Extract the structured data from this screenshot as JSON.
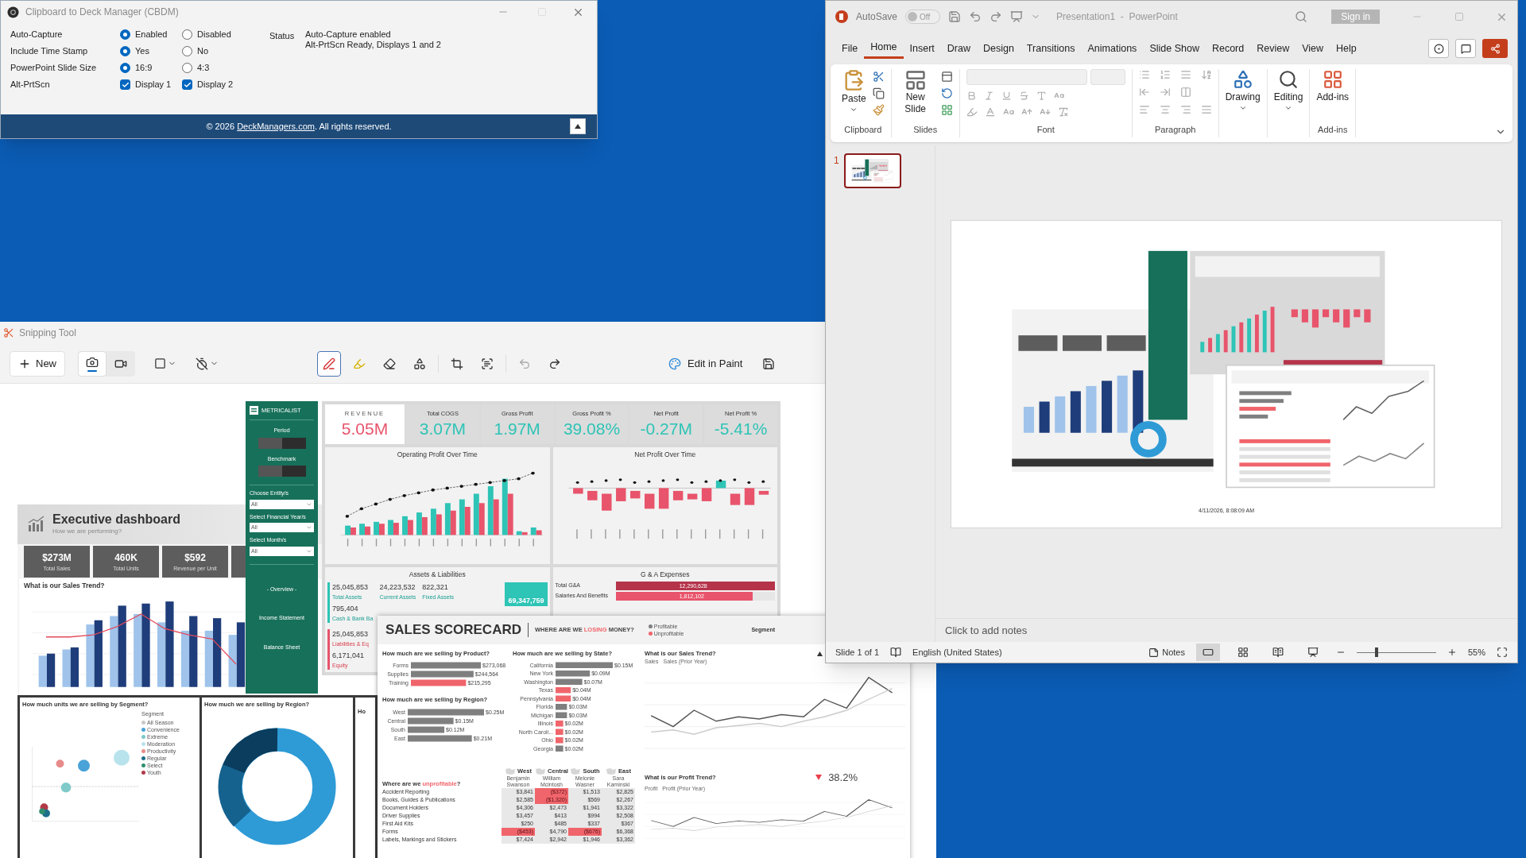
{
  "clipboard_window": {
    "title": "Clipboard to Deck Manager (CBDM)",
    "settings": [
      {
        "label": "Auto-Capture",
        "kind": "radio",
        "options": [
          {
            "label": "Enabled",
            "selected": true
          },
          {
            "label": "Disabled",
            "selected": false
          }
        ]
      },
      {
        "label": "Include Time Stamp",
        "kind": "radio",
        "options": [
          {
            "label": "Yes",
            "selected": true
          },
          {
            "label": "No",
            "selected": false
          }
        ]
      },
      {
        "label": "PowerPoint Slide Size",
        "kind": "radio",
        "options": [
          {
            "label": "16:9",
            "selected": true
          },
          {
            "label": "4:3",
            "selected": false
          }
        ]
      },
      {
        "label": "Alt-PrtScn",
        "kind": "checkbox",
        "options": [
          {
            "label": "Display 1",
            "checked": true
          },
          {
            "label": "Display 2",
            "checked": true
          }
        ]
      }
    ],
    "status": {
      "label": "Status",
      "lines": [
        "Auto-Capture enabled",
        "Alt-PrtScn Ready, Displays 1 and 2"
      ]
    },
    "footer": {
      "prefix": "© 2026 ",
      "link": "DeckManagers.com",
      "suffix": ". All rights reserved."
    }
  },
  "snipping_tool": {
    "title": "Snipping Tool",
    "new_button": "New",
    "capture_modes": [
      {
        "kind": "screenshot",
        "selected": true
      },
      {
        "kind": "video",
        "selected": false
      }
    ],
    "markup_tools": [
      {
        "kind": "pen",
        "selected": true
      },
      {
        "kind": "highlighter",
        "selected": false
      },
      {
        "kind": "eraser",
        "selected": false
      },
      {
        "kind": "shapes",
        "selected": false
      }
    ],
    "edit_in_paint": "Edit in Paint",
    "capture": {
      "exec": {
        "title": "Executive dashboard",
        "subtitle": "How we are performing?",
        "kpis": [
          {
            "value": "$273M",
            "label": "Total Sales"
          },
          {
            "value": "460K",
            "label": "Total Units"
          },
          {
            "value": "$592",
            "label": "Revenue per Unit"
          }
        ],
        "sales_trend_title": "What is our Sales Trend?",
        "segment": {
          "title": "How much units we are selling by Segment?",
          "legend_title": "Segment",
          "legend": [
            {
              "label": "All Season",
              "color": "#c9c9c9"
            },
            {
              "label": "Convenience",
              "color": "#4aa3d8"
            },
            {
              "label": "Extreme",
              "color": "#7fc9c9"
            },
            {
              "label": "Moderation",
              "color": "#b8e3ec"
            },
            {
              "label": "Productivity",
              "color": "#e88b8b"
            },
            {
              "label": "Regular",
              "color": "#1f6f8b"
            },
            {
              "label": "Select",
              "color": "#2f8f6f"
            },
            {
              "label": "Youth",
              "color": "#b03a48"
            }
          ]
        },
        "region_title": "How much we are selling by Region?",
        "partial_title": "Ho"
      },
      "sidebar": {
        "brand": "METRICALIST",
        "sections": [
          "Period",
          "Benchmark"
        ],
        "filters": [
          {
            "label": "Choose Entity/s",
            "value": "All"
          },
          {
            "label": "Select Financial Year/s",
            "value": "All"
          },
          {
            "label": "Select Month/s",
            "value": "All"
          }
        ],
        "nav": [
          "- Overview -",
          "Income Statement",
          "Balance Sheet"
        ]
      },
      "finance": {
        "kpis": [
          {
            "label": "REVENUE",
            "value": "5.05M",
            "kind": "highlight"
          },
          {
            "label": "Total COGS",
            "value": "3.07M",
            "kind": "normal"
          },
          {
            "label": "Gross Profit",
            "value": "1.97M",
            "kind": "normal"
          },
          {
            "label": "Gross Profit %",
            "value": "39.08%",
            "kind": "normal"
          },
          {
            "label": "Net Profit",
            "value": "-0.27M",
            "kind": "normal"
          },
          {
            "label": "Net Profit %",
            "value": "-5.41%",
            "kind": "normal"
          }
        ],
        "charts": [
          {
            "title": "Operating Profit Over Time",
            "kind": "bars"
          },
          {
            "title": "Net Profit Over Time",
            "kind": "waterfall"
          }
        ],
        "assets": {
          "title": "Assets & Liabilities",
          "items": [
            {
              "value": "25,045,853",
              "label": "Total Assets"
            },
            {
              "value": "24,223,532",
              "label": "Current Assets"
            },
            {
              "value": "822,321",
              "label": "Fixed Assets"
            }
          ],
          "cash": {
            "value": "795,404",
            "label": "Cash & Bank Ba"
          },
          "total": "69,347,759",
          "liabilities": [
            {
              "value": "25,045,853",
              "label": "Liabilities & Eq"
            },
            {
              "value": "6,171,041",
              "label": "Equity"
            }
          ]
        },
        "ga": {
          "title": "G & A Expenses",
          "rows": [
            {
              "label": "Total G&A",
              "value": "12,290,628",
              "level": 1
            },
            {
              "label": "Salaries And Benefits",
              "value": "1,812,102",
              "level": 0.86
            }
          ]
        }
      },
      "scorecard": {
        "title": "SALES SCORECARD",
        "tagline": [
          {
            "text": "WHERE ARE WE ",
            "accent": false
          },
          {
            "text": "LOSING",
            "accent": true
          },
          {
            "text": " MONEY?",
            "accent": false
          }
        ],
        "legend": [
          {
            "label": "Profitable",
            "color": "#7f7f7f"
          },
          {
            "label": "Unprofitable",
            "color": "#f0656b"
          }
        ],
        "segment_label": "Segment",
        "product": {
          "title": "How much are we selling by Product?",
          "unprofitable": [
            false,
            false,
            true
          ],
          "chart_data": {
            "type": "bar",
            "orientation": "horizontal",
            "categories": [
              "Forms",
              "Supplies",
              "Training"
            ],
            "values": [
              273068,
              244564,
              215295
            ],
            "value_labels": [
              "$273,068",
              "$244,564",
              "$215,295"
            ]
          }
        },
        "region": {
          "title": "How much are we selling by Region?",
          "unprofitable": [
            false,
            false,
            false,
            false
          ],
          "chart_data": {
            "type": "bar",
            "orientation": "horizontal",
            "categories": [
              "West",
              "Central",
              "South",
              "East"
            ],
            "values": [
              0.25,
              0.15,
              0.12,
              0.21
            ],
            "value_labels": [
              "$0.25M",
              "$0.15M",
              "$0.12M",
              "$0.21M"
            ]
          }
        },
        "state": {
          "title": "How much are we selling by State?",
          "unprofitable": [
            false,
            false,
            false,
            true,
            true,
            false,
            false,
            true,
            true,
            true,
            false
          ],
          "chart_data": {
            "type": "bar",
            "orientation": "horizontal",
            "categories": [
              "California",
              "New York",
              "Washington",
              "Texas",
              "Pennsylvania",
              "Florida",
              "Michigan",
              "Illinois",
              "North Caroli...",
              "Ohio",
              "Georgia"
            ],
            "values": [
              0.15,
              0.09,
              0.07,
              0.04,
              0.04,
              0.03,
              0.03,
              0.02,
              0.02,
              0.02,
              0.02
            ],
            "value_labels": [
              "$0.15M",
              "$0.09M",
              "$0.07M",
              "$0.04M",
              "$0.04M",
              "$0.03M",
              "$0.03M",
              "$0.02M",
              "$0.02M",
              "$0.02M",
              "$0.02M"
            ]
          }
        },
        "sales_trend": {
          "title": "What is our Sales Trend?",
          "legend": [
            "Sales",
            "Sales (Prior Year)"
          ]
        },
        "profit_trend": {
          "title": "What is our Profit Trend?",
          "legend": [
            "Profit",
            "Profit (Prior Year)"
          ],
          "growth": "38.2%"
        },
        "table": {
          "title": [
            {
              "text": "Where are we ",
              "accent": false
            },
            {
              "text": "unprofitable",
              "accent": true
            },
            {
              "text": "?",
              "accent": false
            }
          ],
          "regions": [
            "West",
            "Central",
            "South",
            "East"
          ],
          "managers": [
            "Benjamin Swanson",
            "William Mcintosh",
            "Melonie Wasner",
            "Sara Kaminski"
          ],
          "rows": [
            {
              "label": "Accident Reporting",
              "cells": [
                {
                  "text": "$3,841",
                  "loss": false
                },
                {
                  "text": "($372)",
                  "loss": true
                },
                {
                  "text": "$1,513",
                  "loss": false
                },
                {
                  "text": "$2,825",
                  "loss": false
                }
              ]
            },
            {
              "label": "Books, Guides & Publications",
              "cells": [
                {
                  "text": "$2,585",
                  "loss": false
                },
                {
                  "text": "($1,320)",
                  "loss": true
                },
                {
                  "text": "$569",
                  "loss": false
                },
                {
                  "text": "$2,267",
                  "loss": false
                }
              ]
            },
            {
              "label": "Document Holders",
              "cells": [
                {
                  "text": "$4,306",
                  "loss": false
                },
                {
                  "text": "$2,473",
                  "loss": false
                },
                {
                  "text": "$1,941",
                  "loss": false
                },
                {
                  "text": "$3,322",
                  "loss": false
                }
              ]
            },
            {
              "label": "Driver Supplies",
              "cells": [
                {
                  "text": "$3,457",
                  "loss": false
                },
                {
                  "text": "$413",
                  "loss": false
                },
                {
                  "text": "$994",
                  "loss": false
                },
                {
                  "text": "$2,508",
                  "loss": false
                }
              ]
            },
            {
              "label": "First Aid Kits",
              "cells": [
                {
                  "text": "$250",
                  "loss": false
                },
                {
                  "text": "$485",
                  "loss": false
                },
                {
                  "text": "$337",
                  "loss": false
                },
                {
                  "text": "$367",
                  "loss": false
                }
              ]
            },
            {
              "label": "Forms",
              "cells": [
                {
                  "text": "($453)",
                  "loss": true
                },
                {
                  "text": "$4,790",
                  "loss": false
                },
                {
                  "text": "($676)",
                  "loss": true
                },
                {
                  "text": "$6,368",
                  "loss": false
                }
              ]
            },
            {
              "label": "Labels, Markings and Stickers",
              "cells": [
                {
                  "text": "$7,424",
                  "loss": false
                },
                {
                  "text": "$2,942",
                  "loss": false
                },
                {
                  "text": "$1,946",
                  "loss": false
                },
                {
                  "text": "$3,362",
                  "loss": false
                }
              ]
            }
          ]
        }
      }
    }
  },
  "powerpoint": {
    "autosave": {
      "label": "AutoSave",
      "on": false,
      "state_text": "Off"
    },
    "title": "Presentation1  -  PowerPoint",
    "sign_in": "Sign in",
    "tabs": [
      {
        "label": "File",
        "selected": false
      },
      {
        "label": "Home",
        "selected": true
      },
      {
        "label": "Insert",
        "selected": false
      },
      {
        "label": "Draw",
        "selected": false
      },
      {
        "label": "Design",
        "selected": false
      },
      {
        "label": "Transitions",
        "selected": false
      },
      {
        "label": "Animations",
        "selected": false
      },
      {
        "label": "Slide Show",
        "selected": false
      },
      {
        "label": "Record",
        "selected": false
      },
      {
        "label": "Review",
        "selected": false
      },
      {
        "label": "View",
        "selected": false
      },
      {
        "label": "Help",
        "selected": false
      }
    ],
    "ribbon": [
      {
        "kind": "clipboard",
        "label": "Clipboard",
        "button": "Paste"
      },
      {
        "kind": "slides",
        "label": "Slides",
        "button": "New Slide"
      },
      {
        "kind": "font",
        "label": "Font"
      },
      {
        "kind": "paragraph",
        "label": "Paragraph"
      },
      {
        "kind": "drawing",
        "button": "Drawing"
      },
      {
        "kind": "editing",
        "button": "Editing"
      },
      {
        "kind": "addins",
        "label": "Add-ins",
        "button": "Add-ins"
      }
    ],
    "slides": [
      {
        "number": "1",
        "selected": true
      }
    ],
    "slide": {
      "timestamp": "4/11/2026, 8:08:09 AM"
    },
    "notes": {
      "placeholder": "Click to add notes"
    },
    "status_bar": {
      "slide": "Slide 1 of 1",
      "language": "English (United States)",
      "notes": "Notes",
      "views": [
        {
          "kind": "normal",
          "selected": true
        },
        {
          "kind": "sorter",
          "selected": false
        },
        {
          "kind": "reading",
          "selected": false
        },
        {
          "kind": "slideshow",
          "selected": false
        }
      ],
      "zoom": {
        "level": 0.25,
        "reading": "55%"
      }
    }
  }
}
